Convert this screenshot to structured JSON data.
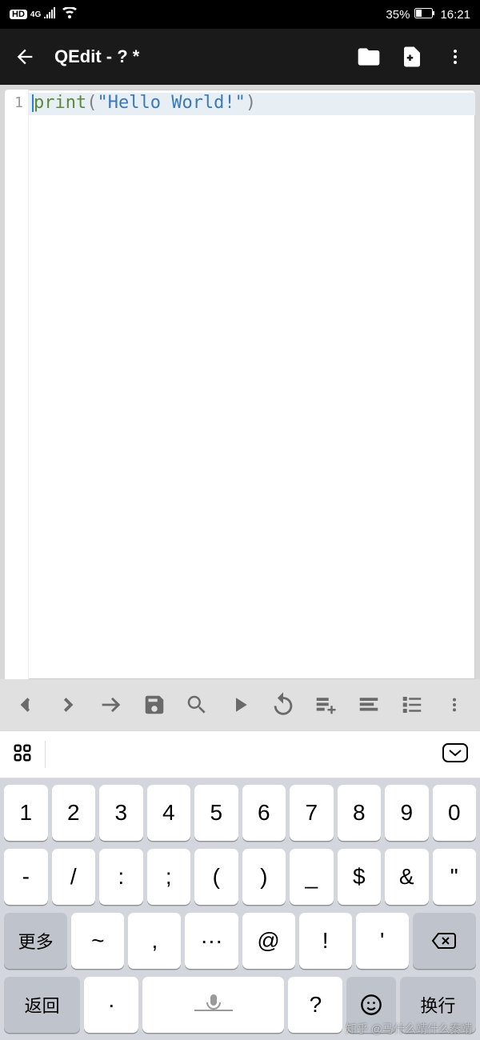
{
  "status": {
    "hd": "HD",
    "network": "4G",
    "battery_pct": "35%",
    "time": "16:21"
  },
  "appbar": {
    "title": "QEdit - ? *"
  },
  "editor": {
    "line_number": "1",
    "tokens": {
      "fn": "print",
      "open": "(",
      "str": "\"Hello World!\"",
      "close": ")"
    }
  },
  "keyboard": {
    "row1": [
      "1",
      "2",
      "3",
      "4",
      "5",
      "6",
      "7",
      "8",
      "9",
      "0"
    ],
    "row2": [
      "-",
      "/",
      ":",
      ";",
      "(",
      ")",
      "_",
      "$",
      "&",
      "\""
    ],
    "row3_more": "更多",
    "row3": [
      "~",
      ",",
      "···",
      "@",
      "!",
      "'"
    ],
    "row4_return": "返回",
    "row4_symbol": "·",
    "row4_question": "?",
    "row4_enter": "换行"
  },
  "watermark": "知乎 @马什么靖什么秦靖"
}
